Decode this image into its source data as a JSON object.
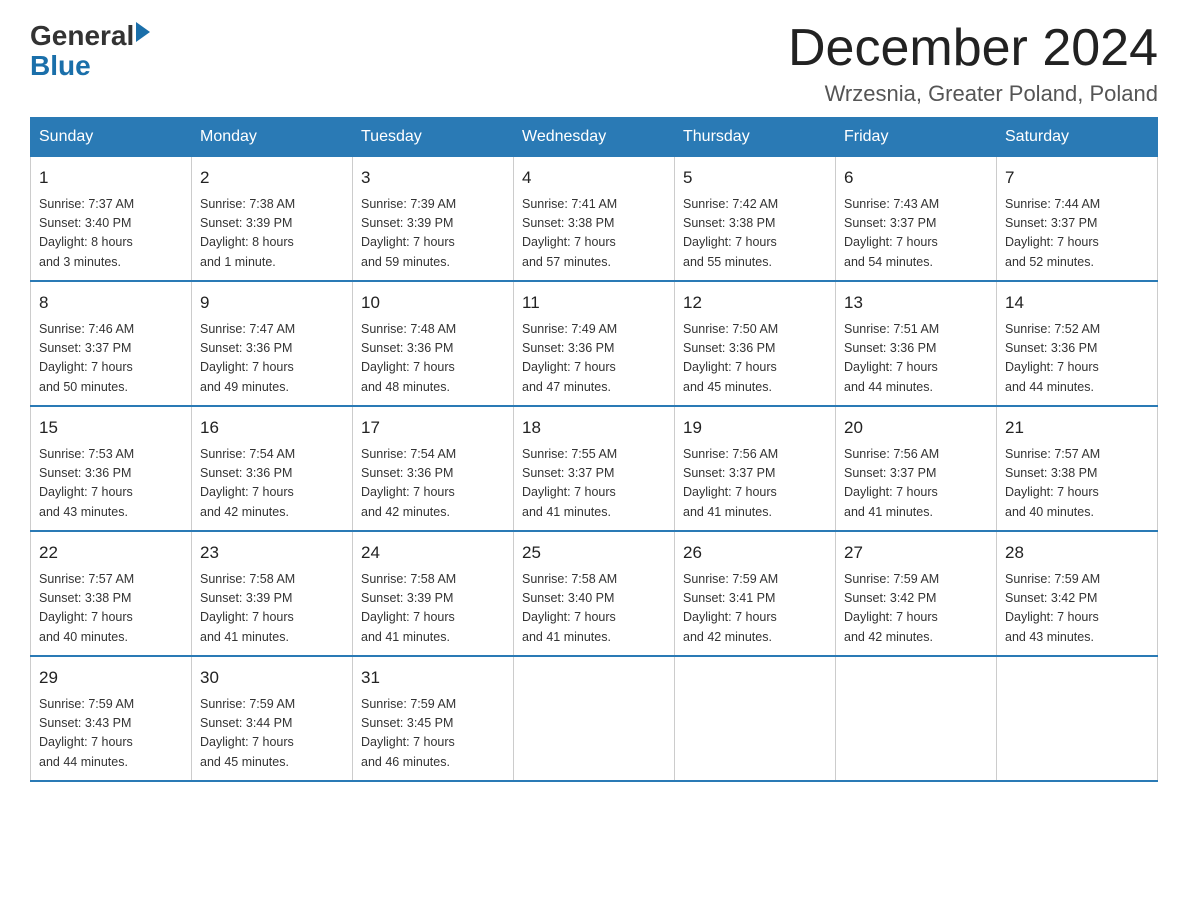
{
  "logo": {
    "general": "General",
    "blue": "Blue",
    "line2": "Blue"
  },
  "header": {
    "month_title": "December 2024",
    "location": "Wrzesnia, Greater Poland, Poland"
  },
  "days_of_week": [
    "Sunday",
    "Monday",
    "Tuesday",
    "Wednesday",
    "Thursday",
    "Friday",
    "Saturday"
  ],
  "weeks": [
    [
      {
        "num": "1",
        "sunrise": "7:37 AM",
        "sunset": "3:40 PM",
        "daylight": "8 hours and 3 minutes."
      },
      {
        "num": "2",
        "sunrise": "7:38 AM",
        "sunset": "3:39 PM",
        "daylight": "8 hours and 1 minute."
      },
      {
        "num": "3",
        "sunrise": "7:39 AM",
        "sunset": "3:39 PM",
        "daylight": "7 hours and 59 minutes."
      },
      {
        "num": "4",
        "sunrise": "7:41 AM",
        "sunset": "3:38 PM",
        "daylight": "7 hours and 57 minutes."
      },
      {
        "num": "5",
        "sunrise": "7:42 AM",
        "sunset": "3:38 PM",
        "daylight": "7 hours and 55 minutes."
      },
      {
        "num": "6",
        "sunrise": "7:43 AM",
        "sunset": "3:37 PM",
        "daylight": "7 hours and 54 minutes."
      },
      {
        "num": "7",
        "sunrise": "7:44 AM",
        "sunset": "3:37 PM",
        "daylight": "7 hours and 52 minutes."
      }
    ],
    [
      {
        "num": "8",
        "sunrise": "7:46 AM",
        "sunset": "3:37 PM",
        "daylight": "7 hours and 50 minutes."
      },
      {
        "num": "9",
        "sunrise": "7:47 AM",
        "sunset": "3:36 PM",
        "daylight": "7 hours and 49 minutes."
      },
      {
        "num": "10",
        "sunrise": "7:48 AM",
        "sunset": "3:36 PM",
        "daylight": "7 hours and 48 minutes."
      },
      {
        "num": "11",
        "sunrise": "7:49 AM",
        "sunset": "3:36 PM",
        "daylight": "7 hours and 47 minutes."
      },
      {
        "num": "12",
        "sunrise": "7:50 AM",
        "sunset": "3:36 PM",
        "daylight": "7 hours and 45 minutes."
      },
      {
        "num": "13",
        "sunrise": "7:51 AM",
        "sunset": "3:36 PM",
        "daylight": "7 hours and 44 minutes."
      },
      {
        "num": "14",
        "sunrise": "7:52 AM",
        "sunset": "3:36 PM",
        "daylight": "7 hours and 44 minutes."
      }
    ],
    [
      {
        "num": "15",
        "sunrise": "7:53 AM",
        "sunset": "3:36 PM",
        "daylight": "7 hours and 43 minutes."
      },
      {
        "num": "16",
        "sunrise": "7:54 AM",
        "sunset": "3:36 PM",
        "daylight": "7 hours and 42 minutes."
      },
      {
        "num": "17",
        "sunrise": "7:54 AM",
        "sunset": "3:36 PM",
        "daylight": "7 hours and 42 minutes."
      },
      {
        "num": "18",
        "sunrise": "7:55 AM",
        "sunset": "3:37 PM",
        "daylight": "7 hours and 41 minutes."
      },
      {
        "num": "19",
        "sunrise": "7:56 AM",
        "sunset": "3:37 PM",
        "daylight": "7 hours and 41 minutes."
      },
      {
        "num": "20",
        "sunrise": "7:56 AM",
        "sunset": "3:37 PM",
        "daylight": "7 hours and 41 minutes."
      },
      {
        "num": "21",
        "sunrise": "7:57 AM",
        "sunset": "3:38 PM",
        "daylight": "7 hours and 40 minutes."
      }
    ],
    [
      {
        "num": "22",
        "sunrise": "7:57 AM",
        "sunset": "3:38 PM",
        "daylight": "7 hours and 40 minutes."
      },
      {
        "num": "23",
        "sunrise": "7:58 AM",
        "sunset": "3:39 PM",
        "daylight": "7 hours and 41 minutes."
      },
      {
        "num": "24",
        "sunrise": "7:58 AM",
        "sunset": "3:39 PM",
        "daylight": "7 hours and 41 minutes."
      },
      {
        "num": "25",
        "sunrise": "7:58 AM",
        "sunset": "3:40 PM",
        "daylight": "7 hours and 41 minutes."
      },
      {
        "num": "26",
        "sunrise": "7:59 AM",
        "sunset": "3:41 PM",
        "daylight": "7 hours and 42 minutes."
      },
      {
        "num": "27",
        "sunrise": "7:59 AM",
        "sunset": "3:42 PM",
        "daylight": "7 hours and 42 minutes."
      },
      {
        "num": "28",
        "sunrise": "7:59 AM",
        "sunset": "3:42 PM",
        "daylight": "7 hours and 43 minutes."
      }
    ],
    [
      {
        "num": "29",
        "sunrise": "7:59 AM",
        "sunset": "3:43 PM",
        "daylight": "7 hours and 44 minutes."
      },
      {
        "num": "30",
        "sunrise": "7:59 AM",
        "sunset": "3:44 PM",
        "daylight": "7 hours and 45 minutes."
      },
      {
        "num": "31",
        "sunrise": "7:59 AM",
        "sunset": "3:45 PM",
        "daylight": "7 hours and 46 minutes."
      },
      null,
      null,
      null,
      null
    ]
  ],
  "labels": {
    "sunrise": "Sunrise:",
    "sunset": "Sunset:",
    "daylight": "Daylight:"
  }
}
